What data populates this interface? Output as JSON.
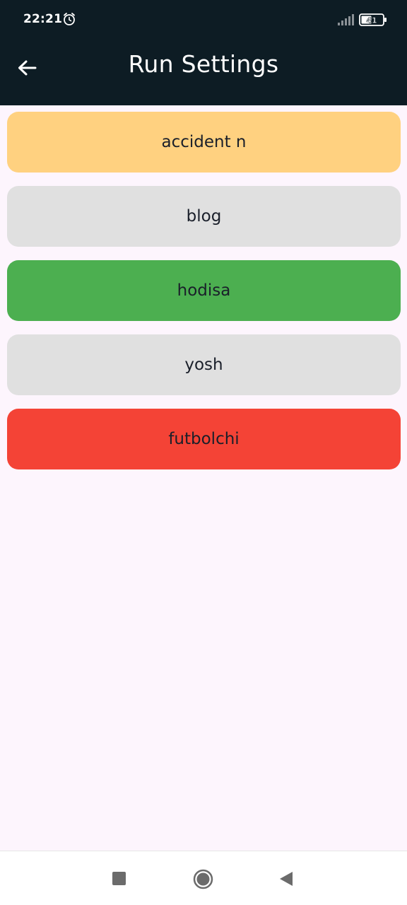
{
  "status_bar": {
    "time": "22:21",
    "battery_level": "41"
  },
  "app_bar": {
    "title": "Run Settings",
    "back_icon": "arrow-left-icon"
  },
  "items": [
    {
      "label": "accident n",
      "color": "#ffd180"
    },
    {
      "label": "blog",
      "color": "#e0e0e0"
    },
    {
      "label": "hodisa",
      "color": "#4caf50"
    },
    {
      "label": "yosh",
      "color": "#e0e0e0"
    },
    {
      "label": "futbolchi",
      "color": "#f44336"
    }
  ],
  "nav_bar": {
    "recents_icon": "square-icon",
    "home_icon": "circle-icon",
    "back_icon": "triangle-back-icon"
  }
}
